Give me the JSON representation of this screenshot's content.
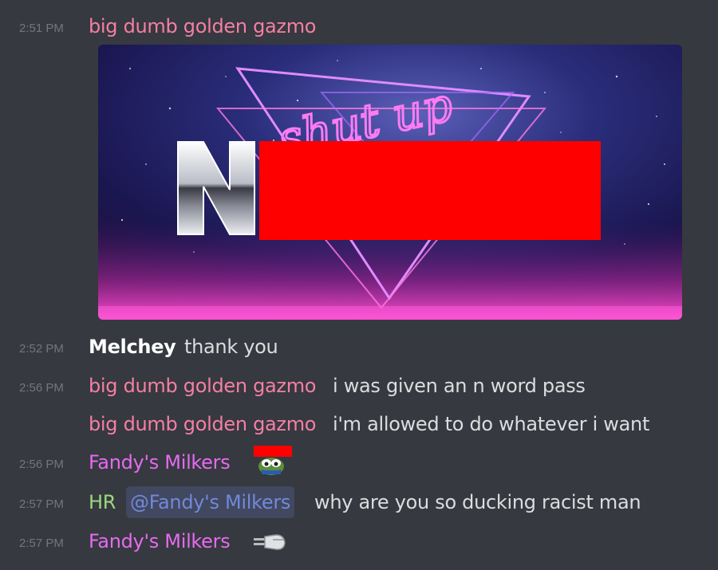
{
  "colors": {
    "background": "#36393f",
    "timestamp": "#72767d",
    "role_pink": "#f47fa4",
    "role_magenta": "#e56bf0",
    "role_green": "#9cd87e",
    "mention": "#7289da",
    "text": "#dcddde"
  },
  "messages": [
    {
      "time": "2:51 PM",
      "author": "big dumb golden gazmo",
      "embed_text": "shut up"
    },
    {
      "time": "2:52 PM",
      "author": "Melchey",
      "text": "thank you"
    },
    {
      "time": "2:56 PM",
      "author": "big dumb golden gazmo",
      "text": "i was given an n word pass"
    },
    {
      "time": "",
      "author": "big dumb golden gazmo",
      "text": "i'm allowed to do whatever i want"
    },
    {
      "time": "2:56 PM",
      "author": "Fandy's Milkers",
      "emoji": "pepe-emoji"
    },
    {
      "time": "2:57 PM",
      "author": "HR",
      "mention": "@Fandy's Milkers",
      "text": "why are you so ducking racist man"
    },
    {
      "time": "2:57 PM",
      "author": "Fandy's Milkers",
      "emoji": "pointing-hand-emoji"
    }
  ]
}
